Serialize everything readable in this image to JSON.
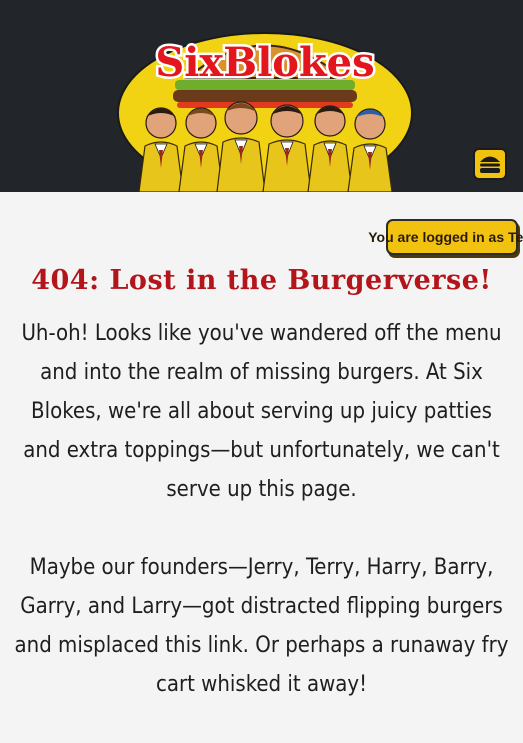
{
  "header": {
    "logo_text": "SixBlokes",
    "menu_icon": "burger-icon"
  },
  "user": {
    "status_text": "You are logged in as Test"
  },
  "main": {
    "title": "404: Lost in the Burgerverse!",
    "paragraphs": [
      "Uh-oh! Looks like you've wandered off the menu and into the realm of missing burgers. At Six Blokes, we're all about serving up juicy patties and extra toppings—but unfortunately, we can't serve up this page.",
      "Maybe our founders—Jerry, Terry, Harry, Barry, Garry, and Larry—got distracted flipping burgers and misplaced this link. Or perhaps a runaway fry cart whisked it away!"
    ]
  },
  "colors": {
    "header_bg": "#22252a",
    "accent_yellow": "#f2c210",
    "title_red": "#b3151b",
    "page_bg": "#f3f4f3"
  }
}
